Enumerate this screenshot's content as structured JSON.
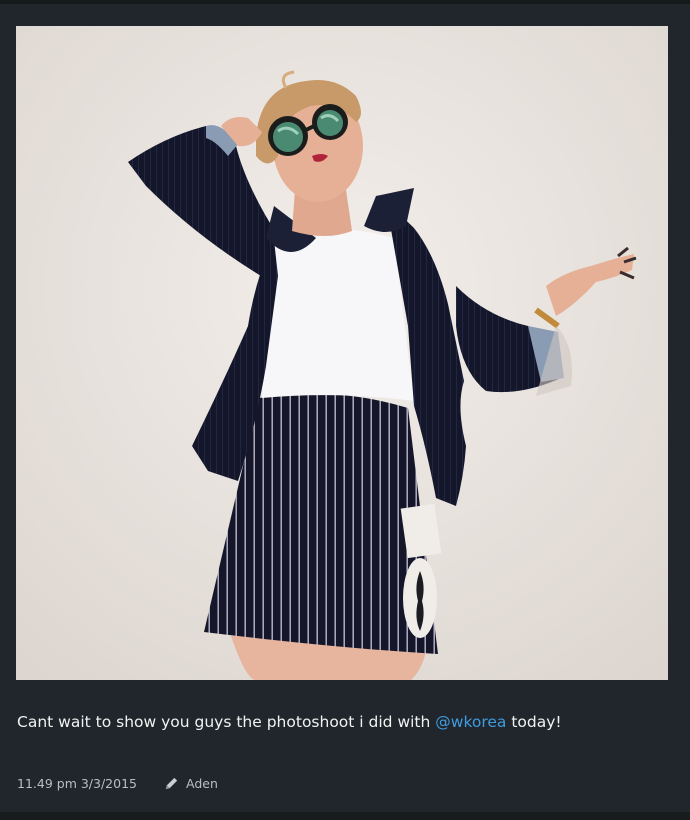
{
  "post": {
    "photo_icon": "photo-image",
    "caption_before": "Cant wait to show you guys the photoshoot i did with ",
    "mention": "@wkorea",
    "caption_after": " today!",
    "timestamp": "11.49 pm 3/3/2015",
    "author_icon": "pencil-icon",
    "author": "Aden",
    "accent_color": "#3f9be0",
    "background_color": "#20262b"
  }
}
